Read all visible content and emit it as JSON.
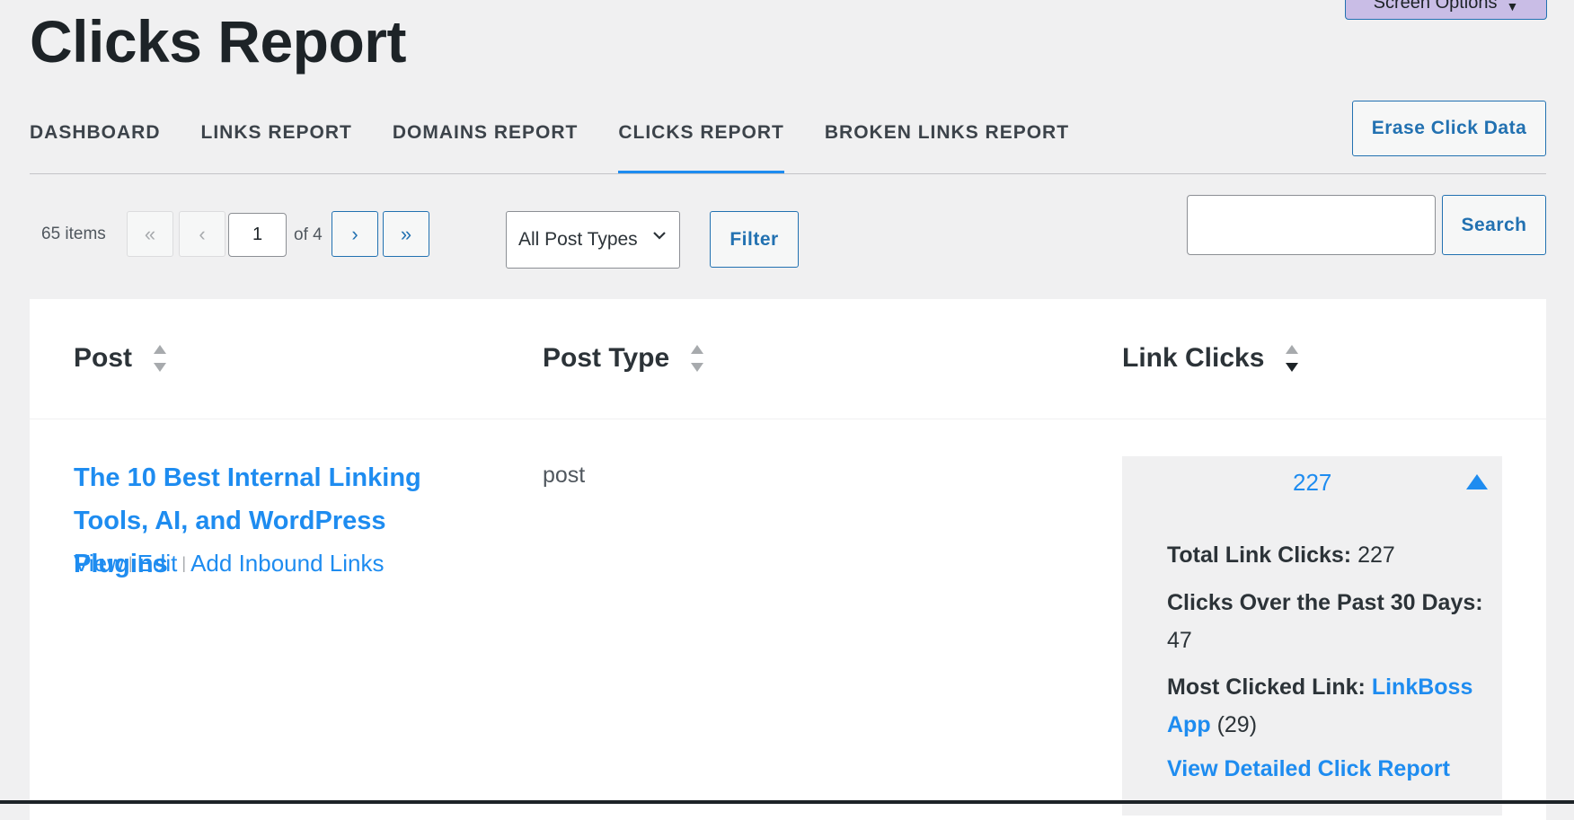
{
  "header": {
    "title": "Clicks Report",
    "screen_options_label": "Screen Options"
  },
  "tabs": [
    {
      "label": "DASHBOARD",
      "active": false
    },
    {
      "label": "LINKS REPORT",
      "active": false
    },
    {
      "label": "DOMAINS REPORT",
      "active": false
    },
    {
      "label": "CLICKS REPORT",
      "active": true
    },
    {
      "label": "BROKEN LINKS REPORT",
      "active": false
    }
  ],
  "toolbar": {
    "erase_label": "Erase Click Data",
    "items_count": "65 items",
    "first_page": "«",
    "prev_page": "‹",
    "current_page": "1",
    "of_pages": "of 4",
    "next_page": "›",
    "last_page": "»",
    "post_type_select": "All Post Types",
    "filter_label": "Filter",
    "search_value": "",
    "search_label": "Search"
  },
  "table": {
    "columns": [
      "Post",
      "Post Type",
      "Link Clicks"
    ],
    "rows": [
      {
        "post_title": "The 10 Best Internal Linking Tools, AI, and WordPress Plugins",
        "actions": [
          "View",
          "Edit",
          "Add Inbound Links"
        ],
        "post_type": "post",
        "link_clicks": "227",
        "details": {
          "total_label": "Total Link Clicks:",
          "total_value": "227",
          "past30_label": "Clicks Over the Past 30 Days:",
          "past30_value": "47",
          "most_clicked_label": "Most Clicked Link:",
          "most_clicked_link": "LinkBoss App",
          "most_clicked_count": "(29)",
          "detail_link": "View Detailed Click Report"
        }
      }
    ]
  },
  "colors": {
    "accent": "#1e8cf0",
    "button_border": "#2271b1",
    "background": "#f0f0f1"
  }
}
